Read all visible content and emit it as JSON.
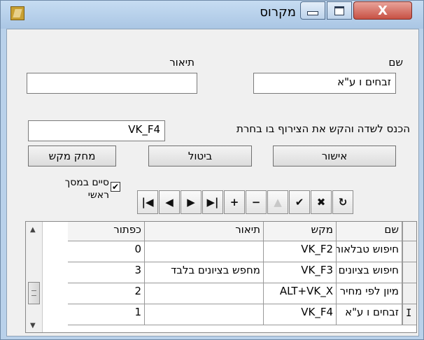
{
  "window": {
    "title": "מקרוס",
    "buttons": {
      "minimize": "minimize",
      "maximize": "maximize",
      "close": "X"
    }
  },
  "form": {
    "name_label": "שם",
    "name_value": "זבחים ו ע\"א",
    "description_label": "תיאור",
    "description_value": "",
    "key_instruction": "הכנס לשדה והקש את הצירוף בו בחרת",
    "key_value": "VK_F4",
    "ok_button": "אישור",
    "cancel_button": "ביטול",
    "delete_key_button": "מחק מקש",
    "close_on_main_label": "סיים במסך ראשי",
    "close_on_main_checked": true
  },
  "navigator": [
    {
      "name": "first",
      "glyph": "|◀",
      "enabled": true
    },
    {
      "name": "prior",
      "glyph": "◀",
      "enabled": true
    },
    {
      "name": "next",
      "glyph": "▶",
      "enabled": true
    },
    {
      "name": "last",
      "glyph": "▶|",
      "enabled": true
    },
    {
      "name": "insert",
      "glyph": "+",
      "enabled": true
    },
    {
      "name": "delete",
      "glyph": "−",
      "enabled": true
    },
    {
      "name": "edit",
      "glyph": "▲",
      "enabled": false
    },
    {
      "name": "post",
      "glyph": "✔",
      "enabled": true
    },
    {
      "name": "cancel",
      "glyph": "✖",
      "enabled": true
    },
    {
      "name": "refresh",
      "glyph": "↻",
      "enabled": true
    }
  ],
  "grid": {
    "columns": [
      "שם",
      "מקש",
      "תיאור",
      "כפתור"
    ],
    "rows": [
      {
        "name": "חיפוש טבלאות",
        "key": "VK_F2",
        "description": "",
        "button": "0"
      },
      {
        "name": "חיפוש בציונים",
        "key": "VK_F3",
        "description": "מחפש בציונים בלבד",
        "button": "3"
      },
      {
        "name": "מיון לפי מחיר",
        "key": "ALT+VK_X",
        "description": "",
        "button": "2"
      },
      {
        "name": "זבחים ו ע\"א",
        "key": "VK_F4",
        "description": "",
        "button": "1"
      }
    ],
    "current_row_marker": "I"
  },
  "colors": {
    "title_bar": "#b9d1ea",
    "close_button": "#c75144",
    "client": "#f0f0f0"
  }
}
